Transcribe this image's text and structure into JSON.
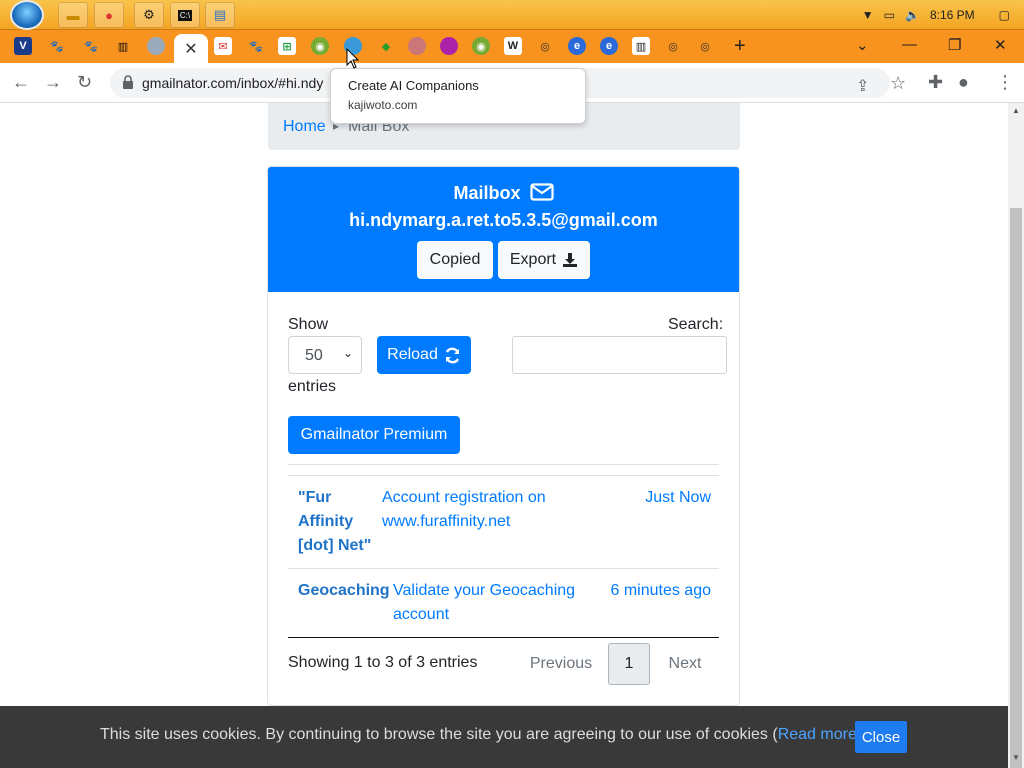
{
  "taskbar": {
    "clock": "8:16 PM",
    "pinned": [
      "folder-icon",
      "chrome-icon",
      "settings-icon",
      "terminal-icon",
      "notepad-icon"
    ]
  },
  "browser": {
    "tab_close": "✕",
    "new_tab": "+",
    "url": "gmailnator.com/inbox/#hi.ndy",
    "tooltip_title": "Create AI Companions",
    "tooltip_domain": "kajiwoto.com"
  },
  "page": {
    "breadcrumb_home": "Home",
    "breadcrumb_current": "Mail Box",
    "mailbox_title": "Mailbox",
    "email": "hi.ndymarg.a.ret.to5.3.5@gmail.com",
    "copied_label": "Copied",
    "export_label": "Export",
    "show_label": "Show",
    "entries_select": "50",
    "entries_label": "entries",
    "reload_label": "Reload",
    "search_label": "Search:",
    "premium_label": "Gmailnator Premium",
    "messages": [
      {
        "from": "\"Fur Affinity [dot] Net\"",
        "subject": "Account registration on www.furaffinity.net",
        "time": "Just Now"
      },
      {
        "from": "Geocaching",
        "subject": "Validate your Geocaching account",
        "time": "6 minutes ago"
      }
    ],
    "showing_text": "Showing 1 to 3 of 3 entries",
    "pager_previous": "Previous",
    "pager_current": "1",
    "pager_next": "Next"
  },
  "cookie": {
    "text_before": "This site uses cookies. By continuing to browse the site you are agreeing to our use of cookies (",
    "link": "Read more",
    "text_after": ")",
    "close_label": "Close"
  },
  "colors": {
    "primary": "#007bff",
    "taskbar": "#f4a424",
    "tabstrip": "#f7931e"
  }
}
